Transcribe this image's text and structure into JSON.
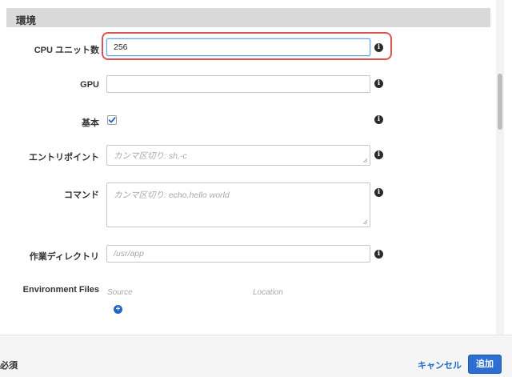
{
  "section": {
    "title": "環境"
  },
  "fields": {
    "cpu_units": {
      "label": "CPU ユニット数",
      "value": "256"
    },
    "gpu": {
      "label": "GPU",
      "value": ""
    },
    "essential": {
      "label": "基本",
      "checked": true
    },
    "entry_point": {
      "label": "エントリポイント",
      "placeholder": "カンマ区切り: sh,-c"
    },
    "command": {
      "label": "コマンド",
      "placeholder": "カンマ区切り: echo,hello world"
    },
    "working_dir": {
      "label": "作業ディレクトリ",
      "placeholder": "/usr/app"
    },
    "environment_files": {
      "label": "Environment Files",
      "source_header": "Source",
      "location_header": "Location"
    }
  },
  "icons": {
    "info": "info-icon",
    "add": "plus-circle-icon",
    "check": "checkmark-icon"
  },
  "info_glyph": "i",
  "add_glyph": "+",
  "footer": {
    "required_label": "必須",
    "cancel_label": "キャンセル",
    "add_label": "追加"
  },
  "colors": {
    "accent": "#2a6fd1",
    "highlight": "#d9534f",
    "header_bg": "#d9d9d9"
  }
}
